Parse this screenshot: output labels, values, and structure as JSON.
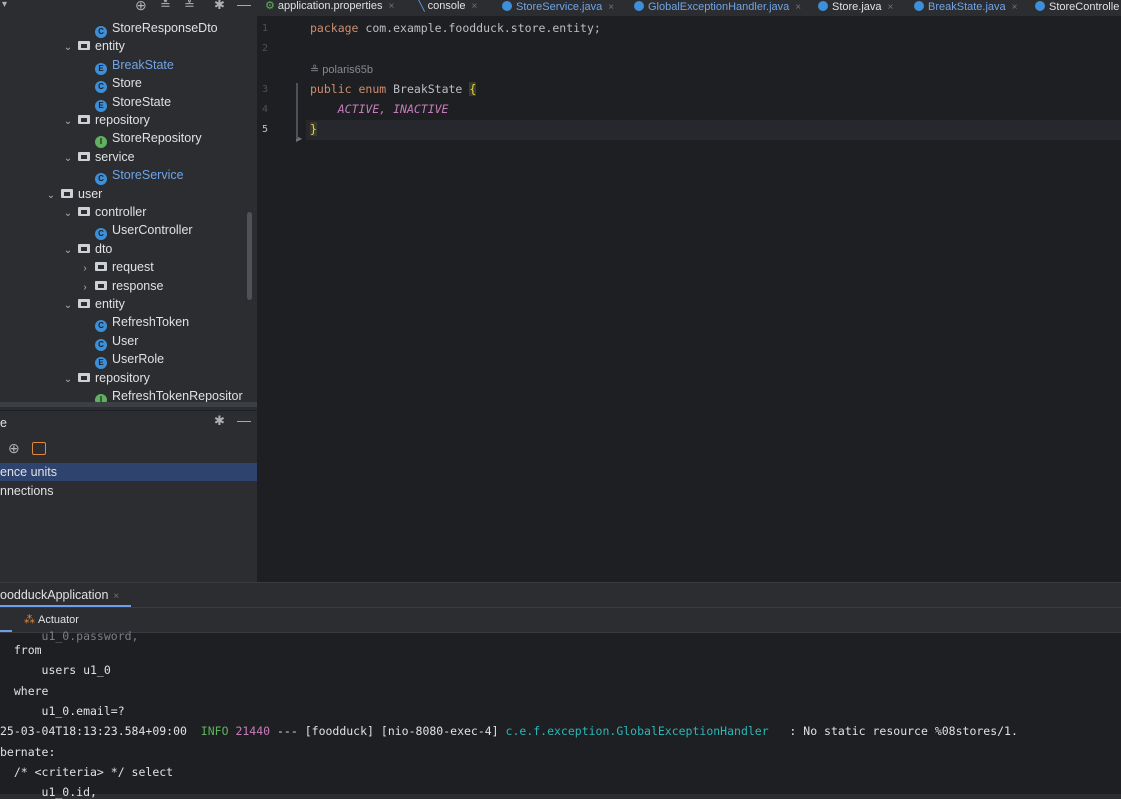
{
  "project_tree": [
    {
      "label": "StoreResponseDto",
      "kind": "class",
      "indent": 4,
      "expandable": false
    },
    {
      "label": "entity",
      "kind": "folder",
      "indent": 3,
      "expanded": true
    },
    {
      "label": "BreakState",
      "kind": "enum",
      "indent": 4,
      "selected": true
    },
    {
      "label": "Store",
      "kind": "class",
      "indent": 4
    },
    {
      "label": "StoreState",
      "kind": "enum",
      "indent": 4
    },
    {
      "label": "repository",
      "kind": "folder",
      "indent": 3,
      "expanded": true
    },
    {
      "label": "StoreRepository",
      "kind": "interface",
      "indent": 4
    },
    {
      "label": "service",
      "kind": "folder",
      "indent": 3,
      "expanded": true
    },
    {
      "label": "StoreService",
      "kind": "class",
      "indent": 4,
      "selected": true
    },
    {
      "label": "user",
      "kind": "folder",
      "indent": 2,
      "expanded": true
    },
    {
      "label": "controller",
      "kind": "folder",
      "indent": 3,
      "expanded": true
    },
    {
      "label": "UserController",
      "kind": "class",
      "indent": 4
    },
    {
      "label": "dto",
      "kind": "folder",
      "indent": 3,
      "expanded": true
    },
    {
      "label": "request",
      "kind": "folder",
      "indent": 4,
      "expanded": false
    },
    {
      "label": "response",
      "kind": "folder",
      "indent": 4,
      "expanded": false
    },
    {
      "label": "entity",
      "kind": "folder",
      "indent": 3,
      "expanded": true
    },
    {
      "label": "RefreshToken",
      "kind": "class",
      "indent": 4
    },
    {
      "label": "User",
      "kind": "class",
      "indent": 4
    },
    {
      "label": "UserRole",
      "kind": "enum",
      "indent": 4
    },
    {
      "label": "repository",
      "kind": "folder",
      "indent": 3,
      "expanded": true
    },
    {
      "label": "RefreshTokenRepositor",
      "kind": "interface",
      "indent": 4
    }
  ],
  "services_panel": {
    "title": "e",
    "items": [
      {
        "label": "ence units",
        "selected": true
      },
      {
        "label": "nnections",
        "selected": false
      }
    ]
  },
  "editor_tabs": [
    {
      "label": "application.properties",
      "active": false
    },
    {
      "label": "console",
      "active": false
    },
    {
      "label": "StoreService.java",
      "active": false
    },
    {
      "label": "GlobalExceptionHandler.java",
      "active": false
    },
    {
      "label": "Store.java",
      "active": false
    },
    {
      "label": "BreakState.java",
      "active": true
    },
    {
      "label": "StoreControlle",
      "active": false
    }
  ],
  "code": {
    "package_kw": "package",
    "package_name": "com.example.foodduck.store.entity;",
    "author": "polaris65b",
    "public_kw": "public",
    "enum_kw": "enum",
    "enum_name": "BreakState",
    "open_brace": "{",
    "constants": "ACTIVE, INACTIVE",
    "close_brace": "}",
    "line_numbers": [
      "1",
      "2",
      "3",
      "4",
      "5"
    ]
  },
  "run": {
    "tab_label": "oodduckApplication",
    "sub_label": "Actuator",
    "log_lines": [
      "  from",
      "      users u1_0",
      "  where",
      "      u1_0.email=?",
      "",
      "bernate:",
      "  /* <criteria> */ select",
      "      u1_0.id,"
    ],
    "log_entry": {
      "timestamp": "25-03-04T18:13:23.584+09:00",
      "level": "INFO",
      "pid": "21440",
      "sep": "---",
      "app": "[foodduck]",
      "thread": "[nio-8080-exec-4]",
      "logger": "c.e.f.exception.GlobalExceptionHandler",
      "message": "   : No static resource %08stores/1."
    }
  },
  "colors": {
    "accent": "#6f9ee8",
    "selection": "#2e436e",
    "editor_bg": "#1e1f22"
  }
}
